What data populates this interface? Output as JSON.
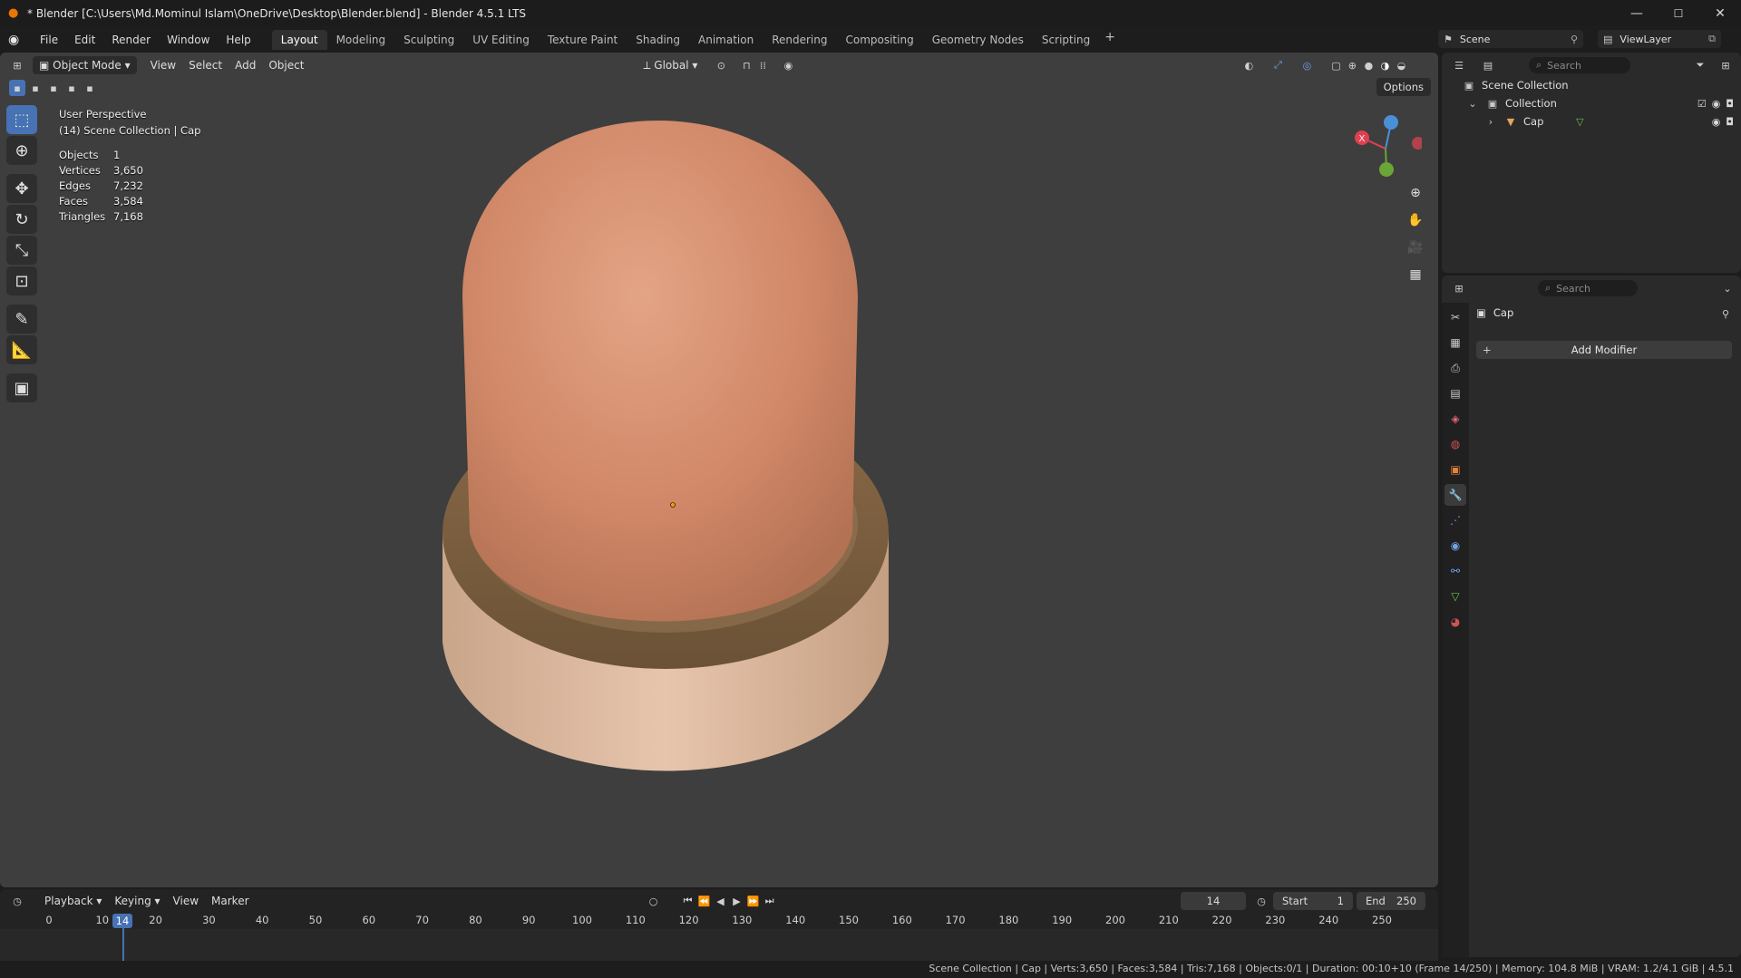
{
  "window": {
    "title": "* Blender [C:\\Users\\Md.Mominul Islam\\OneDrive\\Desktop\\Blender.blend] - Blender 4.5.1 LTS",
    "minimize": "—",
    "maximize": "☐",
    "close": "✕"
  },
  "menu": {
    "items": [
      "File",
      "Edit",
      "Render",
      "Window",
      "Help"
    ],
    "workspaces": [
      "Layout",
      "Modeling",
      "Sculpting",
      "UV Editing",
      "Texture Paint",
      "Shading",
      "Animation",
      "Rendering",
      "Compositing",
      "Geometry Nodes",
      "Scripting"
    ],
    "active_workspace": "Layout",
    "add": "+",
    "scene": "Scene",
    "view_layer": "ViewLayer"
  },
  "viewport": {
    "mode": "Object Mode",
    "menus": [
      "View",
      "Select",
      "Add",
      "Object"
    ],
    "orientation": "Global",
    "options": "Options",
    "perspective": "User Perspective",
    "collection_path": "(14) Scene Collection | Cap",
    "stats": [
      {
        "label": "Objects",
        "value": "1"
      },
      {
        "label": "Vertices",
        "value": "3,650"
      },
      {
        "label": "Edges",
        "value": "7,232"
      },
      {
        "label": "Faces",
        "value": "3,584"
      },
      {
        "label": "Triangles",
        "value": "7,168"
      }
    ],
    "gizmo": {
      "x": "X",
      "y": "Y",
      "z": "Z"
    }
  },
  "timeline": {
    "menus": [
      "Playback",
      "Keying",
      "View",
      "Marker"
    ],
    "current_frame": "14",
    "start_label": "Start",
    "start": "1",
    "end_label": "End",
    "end": "250",
    "ticks": [
      "0",
      "10",
      "20",
      "30",
      "40",
      "50",
      "60",
      "70",
      "80",
      "90",
      "100",
      "110",
      "120",
      "130",
      "140",
      "150",
      "160",
      "170",
      "180",
      "190",
      "200",
      "210",
      "220",
      "230",
      "240",
      "250"
    ]
  },
  "outliner": {
    "search_placeholder": "Search",
    "root": "Scene Collection",
    "collection": "Collection",
    "object": "Cap"
  },
  "properties": {
    "search_placeholder": "Search",
    "object_name": "Cap",
    "add_modifier": "Add Modifier"
  },
  "statusbar": {
    "text": "Scene Collection | Cap | Verts:3,650 | Faces:3,584 | Tris:7,168 | Objects:0/1 | Duration: 00:10+10 (Frame 14/250) | Memory: 104.8 MiB | VRAM: 1.2/4.1 GiB | 4.5.1"
  },
  "colors": {
    "accent": "#4772b3",
    "blender_orange": "#ea7600",
    "axis_x": "#e0404f",
    "axis_y": "#6aa537",
    "axis_z": "#4a90d9"
  }
}
